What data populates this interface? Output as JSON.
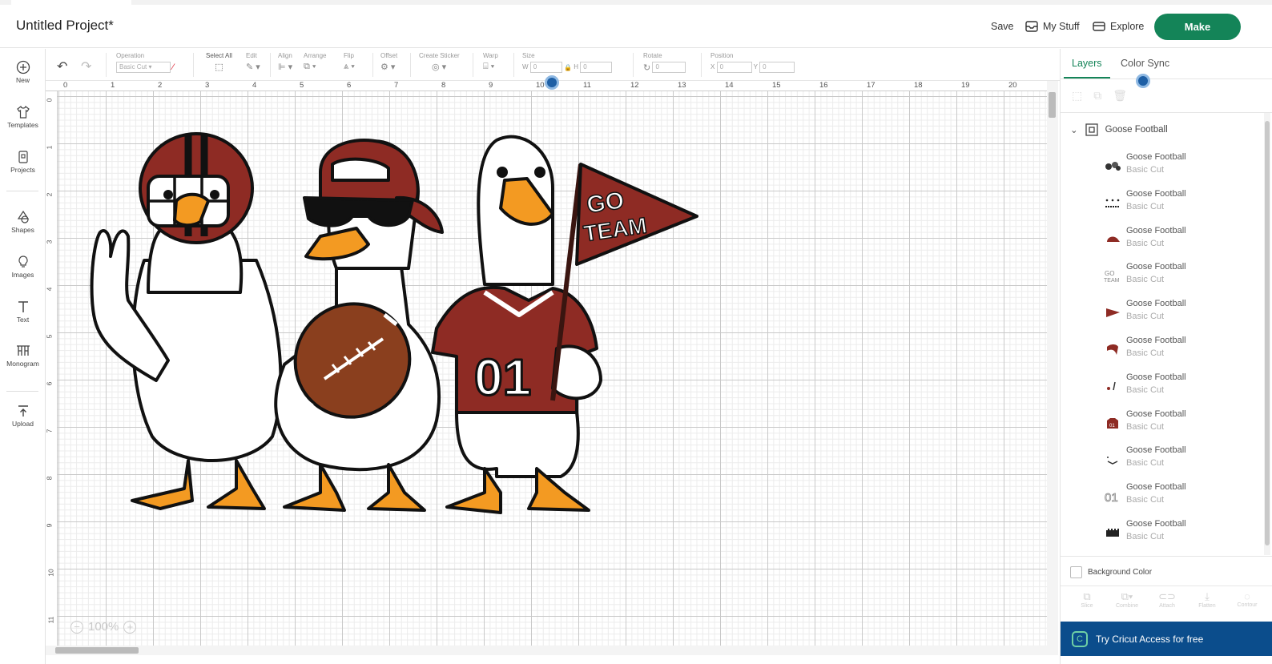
{
  "header": {
    "project_title": "Untitled Project*",
    "save_label": "Save",
    "mystuff_label": "My Stuff",
    "explore_label": "Explore",
    "make_label": "Make"
  },
  "leftbar": {
    "items": [
      {
        "label": "New",
        "icon": "plus-circle-icon"
      },
      {
        "label": "Templates",
        "icon": "shirt-icon"
      },
      {
        "label": "Projects",
        "icon": "projects-icon"
      },
      {
        "label": "Shapes",
        "icon": "shapes-icon"
      },
      {
        "label": "Images",
        "icon": "lightbulb-icon"
      },
      {
        "label": "Text",
        "icon": "text-icon"
      },
      {
        "label": "Monogram",
        "icon": "monogram-icon"
      },
      {
        "label": "Upload",
        "icon": "upload-icon"
      }
    ]
  },
  "toolbar": {
    "operation_label": "Operation",
    "operation_value": "Basic Cut",
    "select_all_label": "Select All",
    "edit_label": "Edit",
    "align_label": "Align",
    "arrange_label": "Arrange",
    "flip_label": "Flip",
    "offset_label": "Offset",
    "create_sticker_label": "Create Sticker",
    "warp_label": "Warp",
    "size_label": "Size",
    "w_label": "W",
    "w_value": "0",
    "h_label": "H",
    "h_value": "0",
    "rotate_label": "Rotate",
    "rotate_value": "0",
    "position_label": "Position",
    "x_label": "X",
    "x_value": "0",
    "y_label": "Y",
    "y_value": "0"
  },
  "rulers": {
    "top": [
      "0",
      "1",
      "2",
      "3",
      "4",
      "5",
      "6",
      "7",
      "8",
      "9",
      "10",
      "11",
      "12",
      "13",
      "14",
      "15",
      "16",
      "17",
      "18",
      "19",
      "20"
    ],
    "left": [
      "0",
      "1",
      "2",
      "3",
      "4",
      "5",
      "6",
      "7",
      "8",
      "9",
      "10",
      "11"
    ]
  },
  "zoom": {
    "value": "100%",
    "minus": "−",
    "plus": "+"
  },
  "artwork": {
    "pennant_line1": "GO",
    "pennant_line2": "TEAM",
    "jersey_number": "01",
    "colors": {
      "maroon": "#8e2b24",
      "orange": "#f39a22",
      "outline": "#111111",
      "white": "#ffffff",
      "football": "#8a3f1e"
    }
  },
  "panel": {
    "tab_layers": "Layers",
    "tab_color_sync": "Color Sync",
    "group_name": "Goose Football",
    "layers": [
      {
        "name": "Goose Football",
        "type": "Basic Cut"
      },
      {
        "name": "Goose Football",
        "type": "Basic Cut"
      },
      {
        "name": "Goose Football",
        "type": "Basic Cut"
      },
      {
        "name": "Goose Football",
        "type": "Basic Cut"
      },
      {
        "name": "Goose Football",
        "type": "Basic Cut"
      },
      {
        "name": "Goose Football",
        "type": "Basic Cut"
      },
      {
        "name": "Goose Football",
        "type": "Basic Cut"
      },
      {
        "name": "Goose Football",
        "type": "Basic Cut"
      },
      {
        "name": "Goose Football",
        "type": "Basic Cut"
      },
      {
        "name": "Goose Football",
        "type": "Basic Cut"
      },
      {
        "name": "Goose Football",
        "type": "Basic Cut"
      }
    ],
    "background_color_label": "Background Color",
    "bottom_tools": [
      "Slice",
      "Combine",
      "Attach",
      "Flatten",
      "Contour"
    ],
    "access_label": "Try Cricut Access for free"
  },
  "colors": {
    "brand_green": "#148458",
    "access_blue": "#0b4d8c"
  }
}
